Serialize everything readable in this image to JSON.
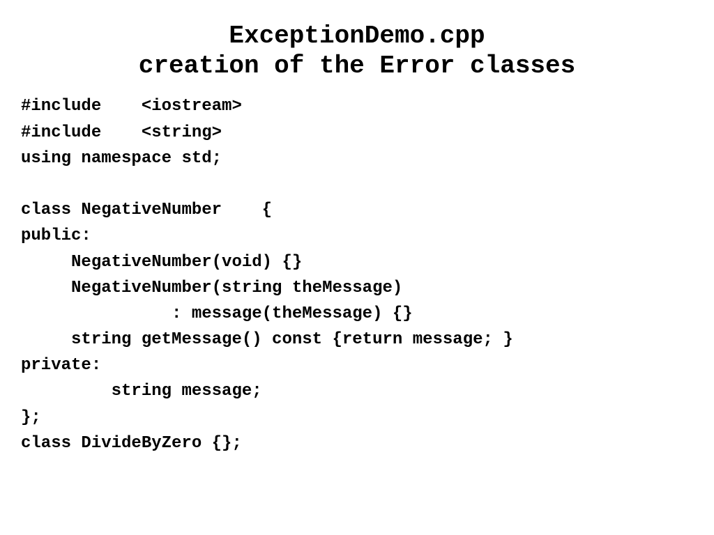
{
  "title": {
    "line1": "ExceptionDemo.cpp",
    "line2": "creation of the Error classes"
  },
  "code": {
    "l1": "#include    <iostream>",
    "l2": "#include    <string>",
    "l3": "using namespace std;",
    "l4": "",
    "l5": "class NegativeNumber    {",
    "l6": "public:",
    "l7": "     NegativeNumber(void) {}",
    "l8": "     NegativeNumber(string theMessage)",
    "l9": "               : message(theMessage) {}",
    "l10": "     string getMessage() const {return message; }",
    "l11": "private:",
    "l12": "         string message;",
    "l13": "};",
    "l14": "class DivideByZero {};"
  }
}
